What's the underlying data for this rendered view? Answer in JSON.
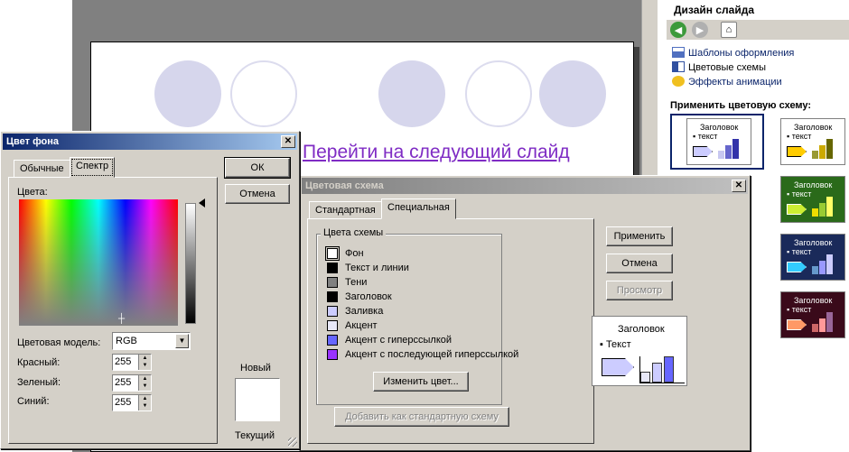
{
  "slide": {
    "link_text": "Перейти на следующий слайд",
    "link_color": "#7f2cc4",
    "circle_fill": "#d6d6ec"
  },
  "task_pane": {
    "title": "Дизайн слайда",
    "toolbar_icons": [
      "back-icon",
      "forward-icon",
      "home-icon"
    ],
    "links": [
      {
        "label": "Шаблоны оформления",
        "icon": "templates-icon"
      },
      {
        "label": "Цветовые схемы",
        "icon": "color-schemes-icon"
      },
      {
        "label": "Эффекты анимации",
        "icon": "animation-icon"
      }
    ],
    "apply_label": "Применить цветовую схему:",
    "schemes": [
      {
        "heading": "Заголовок",
        "text": "▪ текст",
        "bg": "#ffffff",
        "fg": "#000000",
        "arrow": "#ccccff",
        "bars": [
          "#c8c8f0",
          "#6666cc",
          "#3333aa"
        ]
      },
      {
        "heading": "Заголовок",
        "text": "▪ текст",
        "bg": "#ffffff",
        "fg": "#000000",
        "arrow": "#ffcc00",
        "bars": [
          "#999933",
          "#ccaa00",
          "#666600"
        ]
      },
      {
        "heading": "Заголовок",
        "text": "▪ текст",
        "bg": "#2a6a1a",
        "fg": "#ffffff",
        "arrow": "#ccee33",
        "bars": [
          "#eedd00",
          "#99cc33",
          "#ffff66"
        ]
      },
      {
        "heading": "Заголовок",
        "text": "▪ текст",
        "bg": "#1a2a5a",
        "fg": "#ffffff",
        "arrow": "#33ccff",
        "bars": [
          "#6699cc",
          "#9999ff",
          "#ccccff"
        ]
      },
      {
        "heading": "Заголовок",
        "text": "▪ текст",
        "bg": "#3a0a1a",
        "fg": "#ffffff",
        "arrow": "#ff9966",
        "bars": [
          "#cc6666",
          "#ff9999",
          "#996699"
        ]
      }
    ]
  },
  "bg_dialog": {
    "title": "Цвет фона",
    "close": "✕",
    "tabs": [
      "Обычные",
      "Спектр"
    ],
    "colors_label": "Цвета:",
    "model_label": "Цветовая модель:",
    "model_value": "RGB",
    "red_label": "Красный:",
    "green_label": "Зеленый:",
    "blue_label": "Синий:",
    "red": "255",
    "green": "255",
    "blue": "255",
    "ok": "ОК",
    "cancel": "Отмена",
    "new_label": "Новый",
    "current_label": "Текущий"
  },
  "scheme_dialog": {
    "title": "Цветовая схема",
    "close": "✕",
    "tabs": [
      "Стандартная",
      "Специальная"
    ],
    "group_title": "Цвета схемы",
    "items": [
      {
        "label": "Фон",
        "color": "#ffffff"
      },
      {
        "label": "Текст и линии",
        "color": "#000000"
      },
      {
        "label": "Тени",
        "color": "#808080"
      },
      {
        "label": "Заголовок",
        "color": "#000000"
      },
      {
        "label": "Заливка",
        "color": "#ccccff"
      },
      {
        "label": "Акцент",
        "color": "#e8e8f8"
      },
      {
        "label": "Акцент с гиперссылкой",
        "color": "#6666ff"
      },
      {
        "label": "Акцент с последующей гиперссылкой",
        "color": "#9933ff"
      }
    ],
    "change_color": "Изменить цвет...",
    "add_standard": "Добавить как стандартную схему",
    "apply": "Применить",
    "cancel": "Отмена",
    "preview": "Просмотр",
    "preview_heading": "Заголовок",
    "preview_text": "▪ Текст"
  }
}
